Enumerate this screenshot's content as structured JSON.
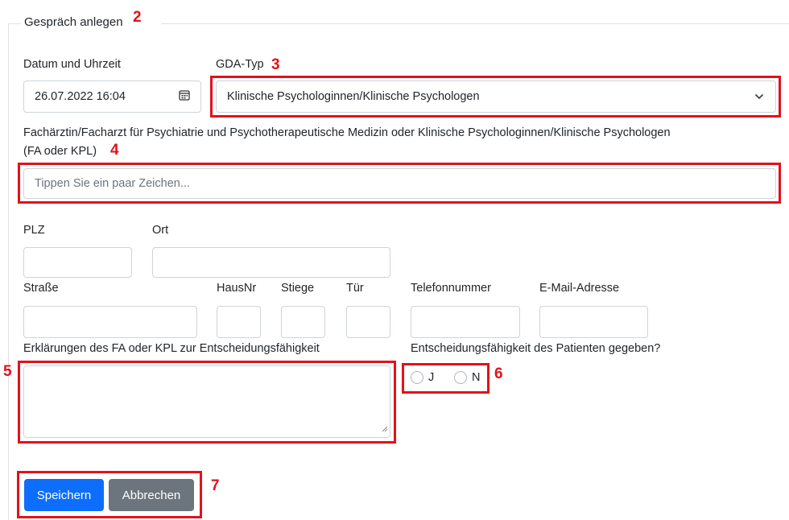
{
  "form": {
    "legend": "Gespräch anlegen",
    "datetime": {
      "label": "Datum und Uhrzeit",
      "value": "26.07.2022 16:04"
    },
    "gda_type": {
      "label": "GDA-Typ",
      "value": "Klinische Psychologinnen/Klinische Psychologen"
    },
    "specialist": {
      "label_line1": "Fachärztin/Facharzt für Psychiatrie und Psychotherapeutische Medizin oder Klinische Psychologinnen/Klinische Psychologen",
      "label_line2": "(FA oder KPL)",
      "placeholder": "Tippen Sie ein paar Zeichen..."
    },
    "plz_label": "PLZ",
    "ort_label": "Ort",
    "strasse_label": "Straße",
    "hausnr_label": "HausNr",
    "stiege_label": "Stiege",
    "tuer_label": "Tür",
    "telefon_label": "Telefonnummer",
    "email_label": "E-Mail-Adresse",
    "explanation_label": "Erklärungen des FA oder KPL zur Entscheidungsfähigkeit",
    "capability": {
      "label": "Entscheidungsfähigkeit des Patienten gegeben?",
      "options": [
        "J",
        "N"
      ]
    },
    "buttons": {
      "save": "Speichern",
      "cancel": "Abbrechen"
    }
  },
  "annotations": [
    "2",
    "3",
    "4",
    "5",
    "6",
    "7"
  ],
  "colors": {
    "primary": "#0d6efd",
    "secondary": "#6c757d",
    "annotation": "#e3111b"
  }
}
